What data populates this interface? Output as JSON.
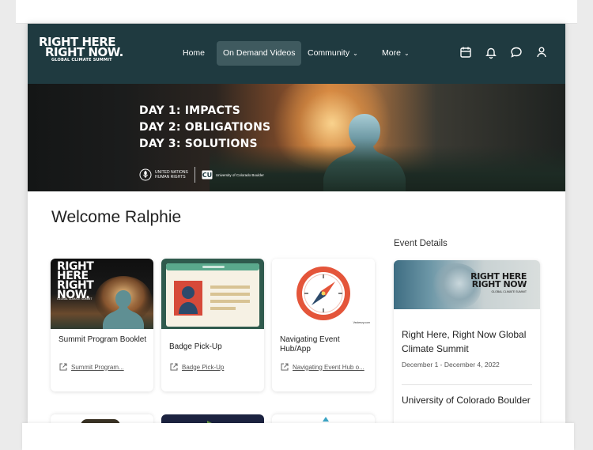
{
  "logo": {
    "line1": "RIGHT HERE",
    "line2": "RIGHT NOW.",
    "line3": "GLOBAL CLIMATE SUMMIT"
  },
  "nav": {
    "home": "Home",
    "on_demand": "On Demand Videos",
    "community": "Community",
    "more": "More"
  },
  "header_icons": [
    "calendar-icon",
    "bell-icon",
    "chat-icon",
    "user-icon"
  ],
  "banner": {
    "line1": "DAY 1: IMPACTS",
    "line2": "DAY 2: OBLIGATIONS",
    "line3": "DAY 3: SOLUTIONS",
    "partner1_line1": "UNITED NATIONS",
    "partner1_line2": "HUMAN RIGHTS",
    "partner2": "University of Colorado Boulder"
  },
  "welcome": "Welcome Ralphie",
  "cards": [
    {
      "title": "Summit Program Booklet",
      "link": "Summit Program...",
      "thumb_text": "RIGHT HERE RIGHT NOW.",
      "thumb_small": "GLOBAL CLIMATE SUMMIT"
    },
    {
      "title": "Badge Pick-Up",
      "link": "Badge Pick-Up"
    },
    {
      "title": "Navigating Event Hub/App",
      "link": "Navigating Event Hub o...",
      "thumb_source": "Vecteezy.com"
    }
  ],
  "event_details": {
    "heading": "Event Details",
    "image_text_line1": "RIGHT HERE",
    "image_text_line2": "RIGHT NOW",
    "image_text_small": "GLOBAL CLIMATE SUMMIT",
    "title": "Right Here, Right Now Global Climate Summit",
    "dates": "December 1 - December 4, 2022",
    "organizer": "University of Colorado Boulder"
  },
  "colors": {
    "header_bg": "#1f3a40",
    "nav_active_bg": "#3f5a5f",
    "badge_card_bg": "#2f5a4d",
    "compass_red": "#e4553a"
  }
}
